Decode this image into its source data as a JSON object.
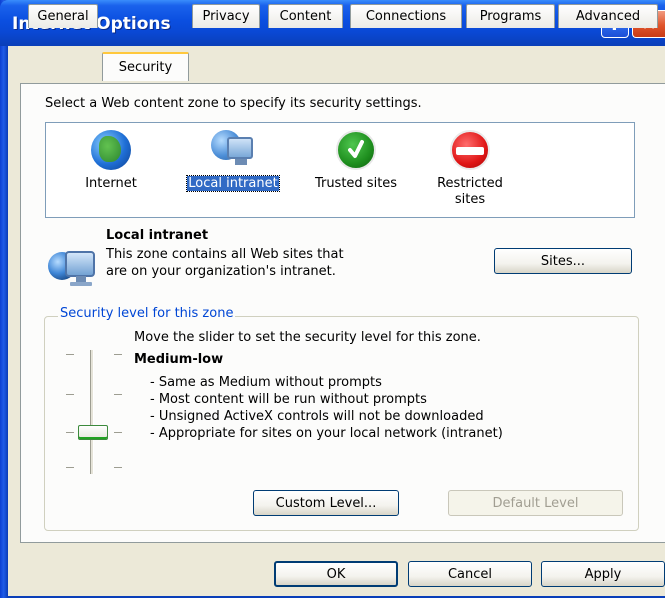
{
  "window": {
    "title": "Internet Options",
    "help_glyph": "?",
    "close_glyph": "✕"
  },
  "tabs": [
    "General",
    "Security",
    "Privacy",
    "Content",
    "Connections",
    "Programs",
    "Advanced"
  ],
  "active_tab": "Security",
  "zone_prompt": "Select a Web content zone to specify its security settings.",
  "zones": [
    {
      "label": "Internet",
      "icon": "globe-icon"
    },
    {
      "label": "Local intranet",
      "icon": "local-intranet-icon",
      "selected": true
    },
    {
      "label": "Trusted sites",
      "icon": "checkmark-icon"
    },
    {
      "label": "Restricted sites",
      "icon": "no-entry-icon"
    }
  ],
  "zone_info": {
    "title": "Local intranet",
    "description_line1": "This zone contains all Web sites that",
    "description_line2": "are on your organization's intranet.",
    "sites_button": "Sites..."
  },
  "security_level": {
    "group_label": "Security level for this zone",
    "slider_hint": "Move the slider to set the security level for this zone.",
    "level_name": "Medium-low",
    "slider_position": "3 of 4",
    "bullets": [
      "- Same as Medium without prompts",
      "- Most content will be run without prompts",
      "- Unsigned ActiveX controls will not be downloaded",
      "- Appropriate for sites on your local network (intranet)"
    ],
    "custom_level_button": "Custom Level...",
    "default_level_button": "Default Level"
  },
  "footer": {
    "ok": "OK",
    "cancel": "Cancel",
    "apply": "Apply"
  },
  "colors": {
    "titlebar": "#0b4fe0",
    "selection": "#316ac5",
    "group_label": "#0046d5",
    "tab_highlight": "#ffc83c"
  }
}
